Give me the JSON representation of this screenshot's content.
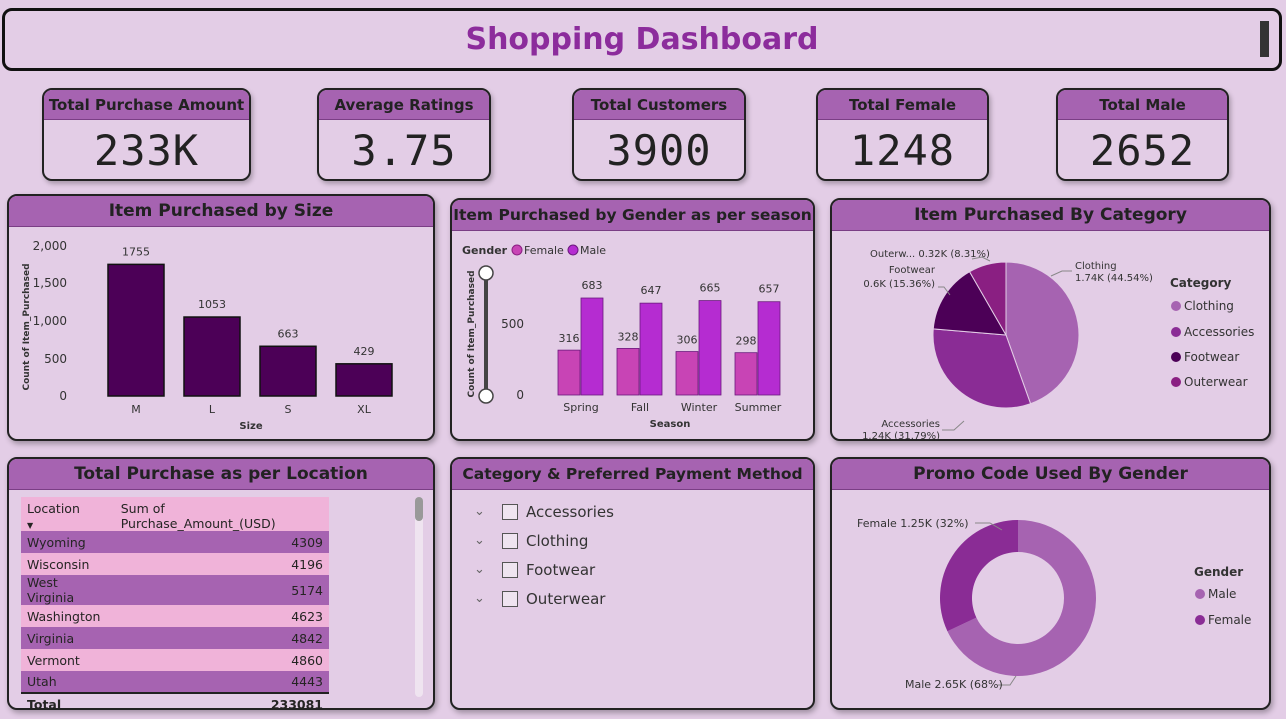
{
  "header": {
    "title": "Shopping Dashboard"
  },
  "kpis": [
    {
      "title": "Total Purchase Amount",
      "value": "233K"
    },
    {
      "title": "Average Ratings",
      "value": "3.75"
    },
    {
      "title": "Total Customers",
      "value": "3900"
    },
    {
      "title": "Total Female",
      "value": "1248"
    },
    {
      "title": "Total Male",
      "value": "2652"
    }
  ],
  "size_chart": {
    "title": "Item Purchased by Size",
    "xlabel": "Size",
    "ylabel": "Count of Item_Purchased",
    "yticks": [
      "2,000",
      "1,500",
      "1,000",
      "500",
      "0"
    ],
    "bars": [
      {
        "label": "M",
        "value": "1755"
      },
      {
        "label": "L",
        "value": "1053"
      },
      {
        "label": "S",
        "value": "663"
      },
      {
        "label": "XL",
        "value": "429"
      }
    ]
  },
  "gender_chart": {
    "title": "Item Purchased by Gender as per season",
    "legend_title": "Gender",
    "legend": [
      "Female",
      "Male"
    ],
    "xlabel": "Season",
    "ylabel": "Count of Item_Purchased",
    "yticks": [
      "500",
      "0"
    ],
    "groups": [
      {
        "label": "Spring",
        "female": "316",
        "male": "683"
      },
      {
        "label": "Fall",
        "female": "328",
        "male": "647"
      },
      {
        "label": "Winter",
        "female": "306",
        "male": "665"
      },
      {
        "label": "Summer",
        "female": "298",
        "male": "657"
      }
    ]
  },
  "category_chart": {
    "title": "Item Purchased By Category",
    "legend_title": "Category",
    "legend": [
      "Clothing",
      "Accessories",
      "Footwear",
      "Outerwear"
    ],
    "labels": {
      "clothing_name": "Clothing",
      "clothing_val": "1.74K (44.54%)",
      "accessories_name": "Accessories",
      "accessories_val": "1.24K (31.79%)",
      "footwear_name": "Footwear",
      "footwear_val": "0.6K (15.36%)",
      "outerwear": "Outerw... 0.32K (8.31%)"
    }
  },
  "location_table": {
    "title": "Total Purchase as per Location",
    "col1": "Location",
    "col2": "Sum of Purchase_Amount_(USD)",
    "rows": [
      {
        "location": "Wyoming",
        "amount": "4309"
      },
      {
        "location": "Wisconsin",
        "amount": "4196"
      },
      {
        "location": "West Virginia",
        "amount": "5174"
      },
      {
        "location": "Washington",
        "amount": "4623"
      },
      {
        "location": "Virginia",
        "amount": "4842"
      },
      {
        "location": "Vermont",
        "amount": "4860"
      },
      {
        "location": "Utah",
        "amount": "4443"
      }
    ],
    "total_label": "Total",
    "total_value": "233081"
  },
  "slicer": {
    "title": "Category & Preferred Payment Method",
    "items": [
      "Accessories",
      "Clothing",
      "Footwear",
      "Outerwear"
    ]
  },
  "promo_chart": {
    "title": "Promo Code Used By Gender",
    "legend_title": "Gender",
    "legend": [
      "Male",
      "Female"
    ],
    "female_label": "Female 1.25K (32%)",
    "male_label": "Male 2.65K (68%)"
  },
  "chart_data": [
    {
      "type": "bar",
      "title": "Item Purchased by Size",
      "categories": [
        "M",
        "L",
        "S",
        "XL"
      ],
      "values": [
        1755,
        1053,
        663,
        429
      ],
      "xlabel": "Size",
      "ylabel": "Count of Item_Purchased",
      "ylim": [
        0,
        2000
      ]
    },
    {
      "type": "bar",
      "title": "Item Purchased by Gender as per season",
      "categories": [
        "Spring",
        "Fall",
        "Winter",
        "Summer"
      ],
      "series": [
        {
          "name": "Female",
          "values": [
            316,
            328,
            306,
            298
          ]
        },
        {
          "name": "Male",
          "values": [
            683,
            647,
            665,
            657
          ]
        }
      ],
      "xlabel": "Season",
      "ylabel": "Count of Item_Purchased"
    },
    {
      "type": "pie",
      "title": "Item Purchased By Category",
      "categories": [
        "Clothing",
        "Accessories",
        "Footwear",
        "Outerwear"
      ],
      "values": [
        1740,
        1240,
        600,
        320
      ],
      "percent": [
        44.54,
        31.79,
        15.36,
        8.31
      ],
      "legend_position": "right"
    },
    {
      "type": "pie",
      "title": "Promo Code Used By Gender",
      "categories": [
        "Male",
        "Female"
      ],
      "values": [
        2650,
        1250
      ],
      "percent": [
        68,
        32
      ],
      "legend_position": "right"
    }
  ],
  "colors": {
    "background": "#e3cde6",
    "title_bar": "#a663b1",
    "size_bar": "#4c0057",
    "female": "#c844b5",
    "male": "#b52cd1",
    "clothing": "#a663b1",
    "accessories": "#8a2c95",
    "footwear": "#4c0057",
    "outerwear": "#8a1f82",
    "promo_male": "#a663b1",
    "promo_female": "#8a2c95"
  }
}
